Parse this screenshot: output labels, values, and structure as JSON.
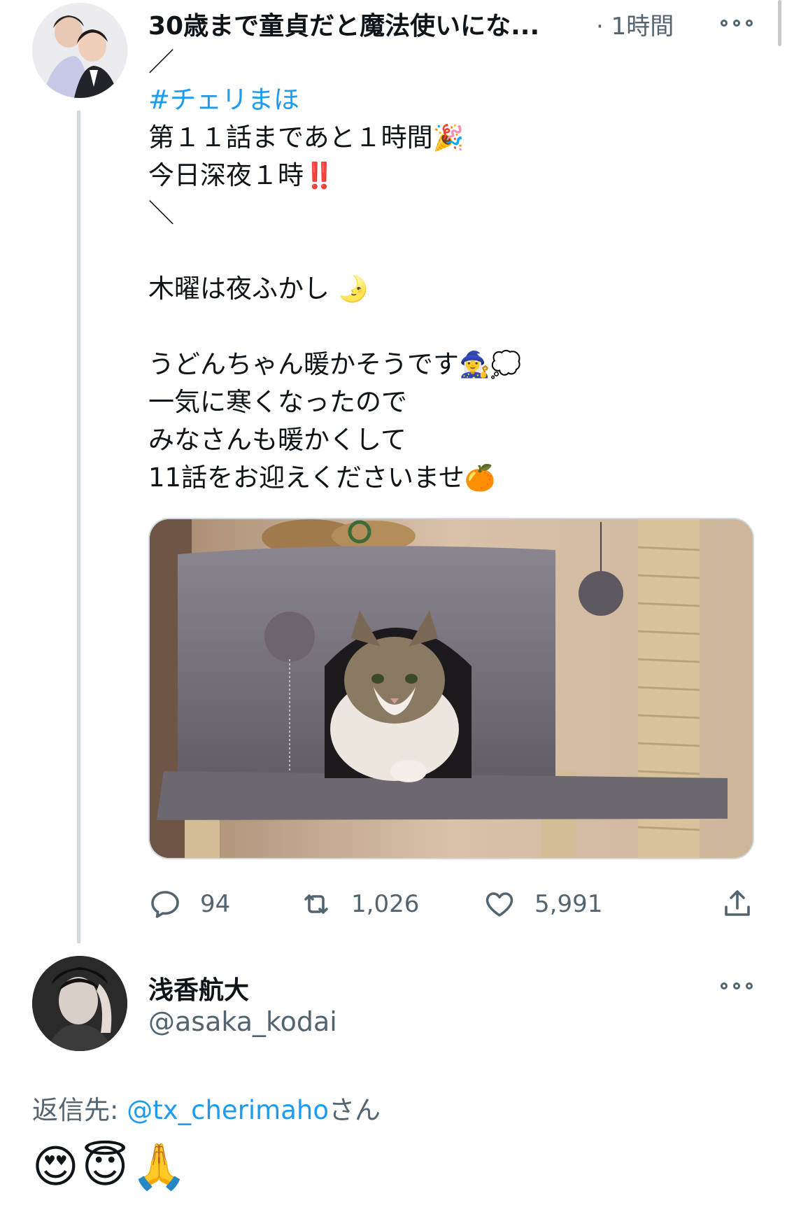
{
  "tweet": {
    "display_name": "30歳まで童貞だと魔法使いにな...",
    "time": "· 1時間",
    "lines": [
      {
        "text": "／",
        "emoji": ""
      },
      {
        "text": "#チェリまほ",
        "emoji": "",
        "hashtag": true
      },
      {
        "text": "第１１話まであと１時間",
        "emoji": "🎉"
      },
      {
        "text": "今日深夜１時",
        "emoji": "‼️"
      },
      {
        "text": "＼",
        "emoji": ""
      },
      {
        "text": "",
        "emoji": ""
      },
      {
        "text": "木曜は夜ふかし",
        "emoji": "🌛"
      },
      {
        "text": "",
        "emoji": ""
      },
      {
        "text": "うどんちゃん暖かそうです",
        "emoji": "🧙‍♀️💭"
      },
      {
        "text": "一気に寒くなったので",
        "emoji": ""
      },
      {
        "text": "みなさんも暖かくして",
        "emoji": ""
      },
      {
        "text": "11話をお迎えくださいませ",
        "emoji": "🍊"
      }
    ],
    "actions": {
      "reply_count": "94",
      "retweet_count": "1,026",
      "like_count": "5,991"
    },
    "icons": {
      "more": "more-icon",
      "reply": "reply-icon",
      "retweet": "retweet-icon",
      "like": "heart-icon",
      "share": "share-icon"
    }
  },
  "reply": {
    "display_name": "浅香航大",
    "handle": "@asaka_kodai",
    "reply_to_prefix": "返信先: ",
    "reply_to_mention": "@tx_cherimaho",
    "reply_to_suffix": "さん",
    "body_emoji": "😍😇🙏"
  },
  "colors": {
    "link": "#1d9bf0",
    "secondary_text": "#536471",
    "thread_line": "#cfd9de"
  }
}
